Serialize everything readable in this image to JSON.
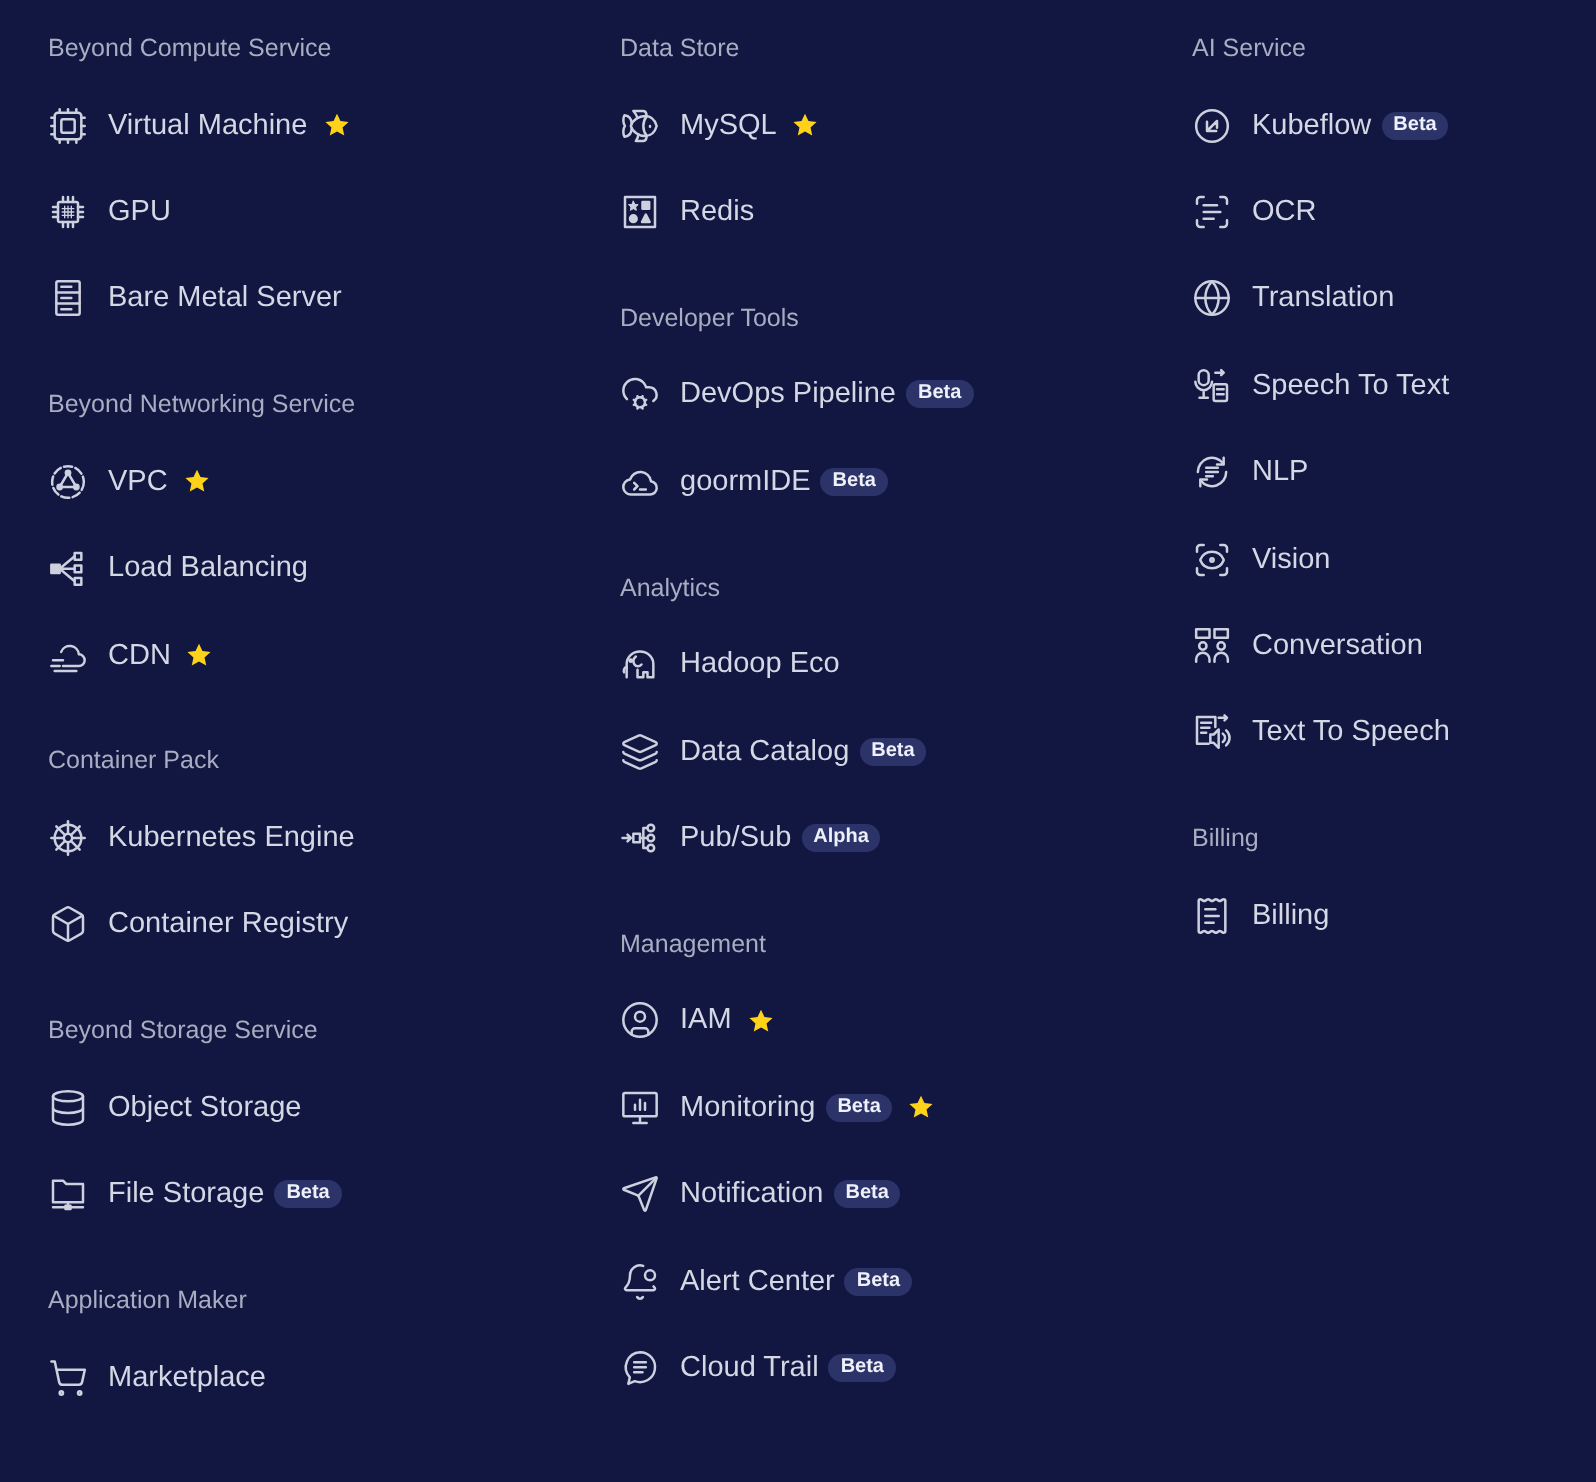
{
  "columns": [
    {
      "sections": [
        {
          "heading": "Beyond Compute Service",
          "items": [
            {
              "label": "Virtual Machine",
              "starred": true
            },
            {
              "label": "GPU",
              "starred": false
            },
            {
              "label": "Bare Metal Server",
              "starred": false
            }
          ]
        },
        {
          "heading": "Beyond Networking Service",
          "items": [
            {
              "label": "VPC",
              "starred": true
            },
            {
              "label": "Load Balancing",
              "starred": false
            },
            {
              "label": "CDN",
              "starred": true
            }
          ]
        },
        {
          "heading": "Container Pack",
          "items": [
            {
              "label": "Kubernetes Engine",
              "starred": false
            },
            {
              "label": "Container Registry",
              "starred": false
            }
          ]
        },
        {
          "heading": "Beyond Storage Service",
          "items": [
            {
              "label": "Object Storage",
              "starred": false
            },
            {
              "label": "File Storage",
              "badge": "Beta",
              "starred": false
            }
          ]
        },
        {
          "heading": "Application Maker",
          "items": [
            {
              "label": "Marketplace",
              "starred": false
            }
          ]
        }
      ]
    },
    {
      "sections": [
        {
          "heading": "Data Store",
          "items": [
            {
              "label": "MySQL",
              "starred": true
            },
            {
              "label": "Redis",
              "starred": false
            }
          ]
        },
        {
          "heading": "Developer Tools",
          "items": [
            {
              "label": "DevOps Pipeline",
              "badge": "Beta",
              "starred": false
            },
            {
              "label": "goormIDE",
              "badge": "Beta",
              "starred": false
            }
          ]
        },
        {
          "heading": "Analytics",
          "items": [
            {
              "label": "Hadoop Eco",
              "starred": false
            },
            {
              "label": "Data Catalog",
              "badge": "Beta",
              "starred": false
            },
            {
              "label": "Pub/Sub",
              "badge": "Alpha",
              "starred": false
            }
          ]
        },
        {
          "heading": "Management",
          "items": [
            {
              "label": "IAM",
              "starred": true
            },
            {
              "label": "Monitoring",
              "badge": "Beta",
              "starred": true
            },
            {
              "label": "Notification",
              "badge": "Beta",
              "starred": false
            },
            {
              "label": "Alert Center",
              "badge": "Beta",
              "starred": false
            },
            {
              "label": "Cloud Trail",
              "badge": "Beta",
              "starred": false
            }
          ]
        }
      ]
    },
    {
      "sections": [
        {
          "heading": "AI Service",
          "items": [
            {
              "label": "Kubeflow",
              "badge": "Beta",
              "starred": false
            },
            {
              "label": "OCR",
              "starred": false
            },
            {
              "label": "Translation",
              "starred": false
            },
            {
              "label": "Speech To Text",
              "starred": false
            },
            {
              "label": "NLP",
              "starred": false
            },
            {
              "label": "Vision",
              "starred": false
            },
            {
              "label": "Conversation",
              "starred": false
            },
            {
              "label": "Text To Speech",
              "starred": false
            }
          ]
        },
        {
          "heading": "Billing",
          "items": [
            {
              "label": "Billing",
              "starred": false
            }
          ]
        }
      ]
    }
  ]
}
